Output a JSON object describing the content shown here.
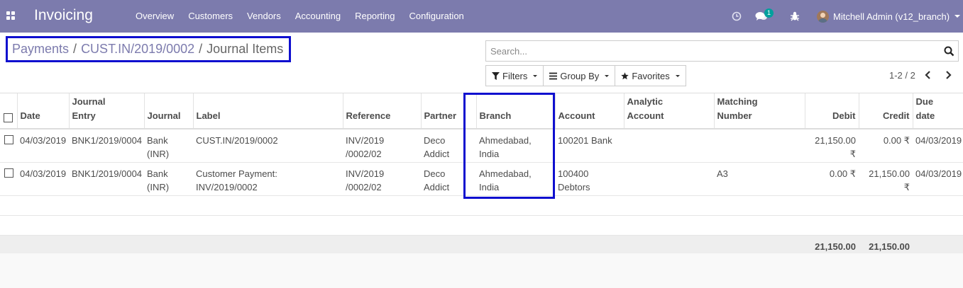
{
  "app": {
    "name": "Invoicing"
  },
  "menu": [
    "Overview",
    "Customers",
    "Vendors",
    "Accounting",
    "Reporting",
    "Configuration"
  ],
  "systray": {
    "messages_count": "1",
    "user_name": "Mitchell Admin (v12_branch)"
  },
  "breadcrumb": {
    "items": [
      "Payments",
      "CUST.IN/2019/0002"
    ],
    "separator": "/",
    "active": "Journal Items"
  },
  "search": {
    "placeholder": "Search..."
  },
  "buttons": {
    "filters": "Filters",
    "group_by": "Group By",
    "favorites": "Favorites"
  },
  "pager": {
    "value": "1-2 / 2"
  },
  "table": {
    "headers": {
      "date": "Date",
      "journal_entry": [
        "Journal",
        "Entry"
      ],
      "journal": "Journal",
      "label": "Label",
      "reference": "Reference",
      "partner": "Partner",
      "branch": "Branch",
      "account": "Account",
      "analytic_account": [
        "Analytic",
        "Account"
      ],
      "matching_number": [
        "Matching",
        "Number"
      ],
      "debit": "Debit",
      "credit": "Credit",
      "due_date": [
        "Due",
        "date"
      ]
    },
    "rows": [
      {
        "date": "04/03/2019",
        "journal_entry": "BNK1/2019/0004",
        "journal": [
          "Bank",
          "(INR)"
        ],
        "label": [
          "CUST.IN/2019/0002",
          ""
        ],
        "reference": [
          "INV/2019",
          "/0002/02"
        ],
        "partner": [
          "Deco",
          "Addict"
        ],
        "branch": [
          "Ahmedabad,",
          "India"
        ],
        "account": [
          "100201 Bank",
          ""
        ],
        "analytic_account": "",
        "matching_number": "",
        "debit": "21,150.00 ₹",
        "credit": "0.00 ₹",
        "due_date": "04/03/2019"
      },
      {
        "date": "04/03/2019",
        "journal_entry": "BNK1/2019/0004",
        "journal": [
          "Bank",
          "(INR)"
        ],
        "label": [
          "Customer Payment:",
          "INV/2019/0002"
        ],
        "reference": [
          "INV/2019",
          "/0002/02"
        ],
        "partner": [
          "Deco",
          "Addict"
        ],
        "branch": [
          "Ahmedabad,",
          "India"
        ],
        "account": [
          "100400",
          "Debtors"
        ],
        "analytic_account": "",
        "matching_number": "A3",
        "debit": "0.00 ₹",
        "credit": "21,150.00 ₹",
        "due_date": "04/03/2019"
      }
    ],
    "totals": {
      "debit": "21,150.00",
      "credit": "21,150.00"
    }
  },
  "colors": {
    "navbar": "#7c7bad",
    "highlight_box": "#0f0fcf",
    "badge": "#00a09d"
  }
}
